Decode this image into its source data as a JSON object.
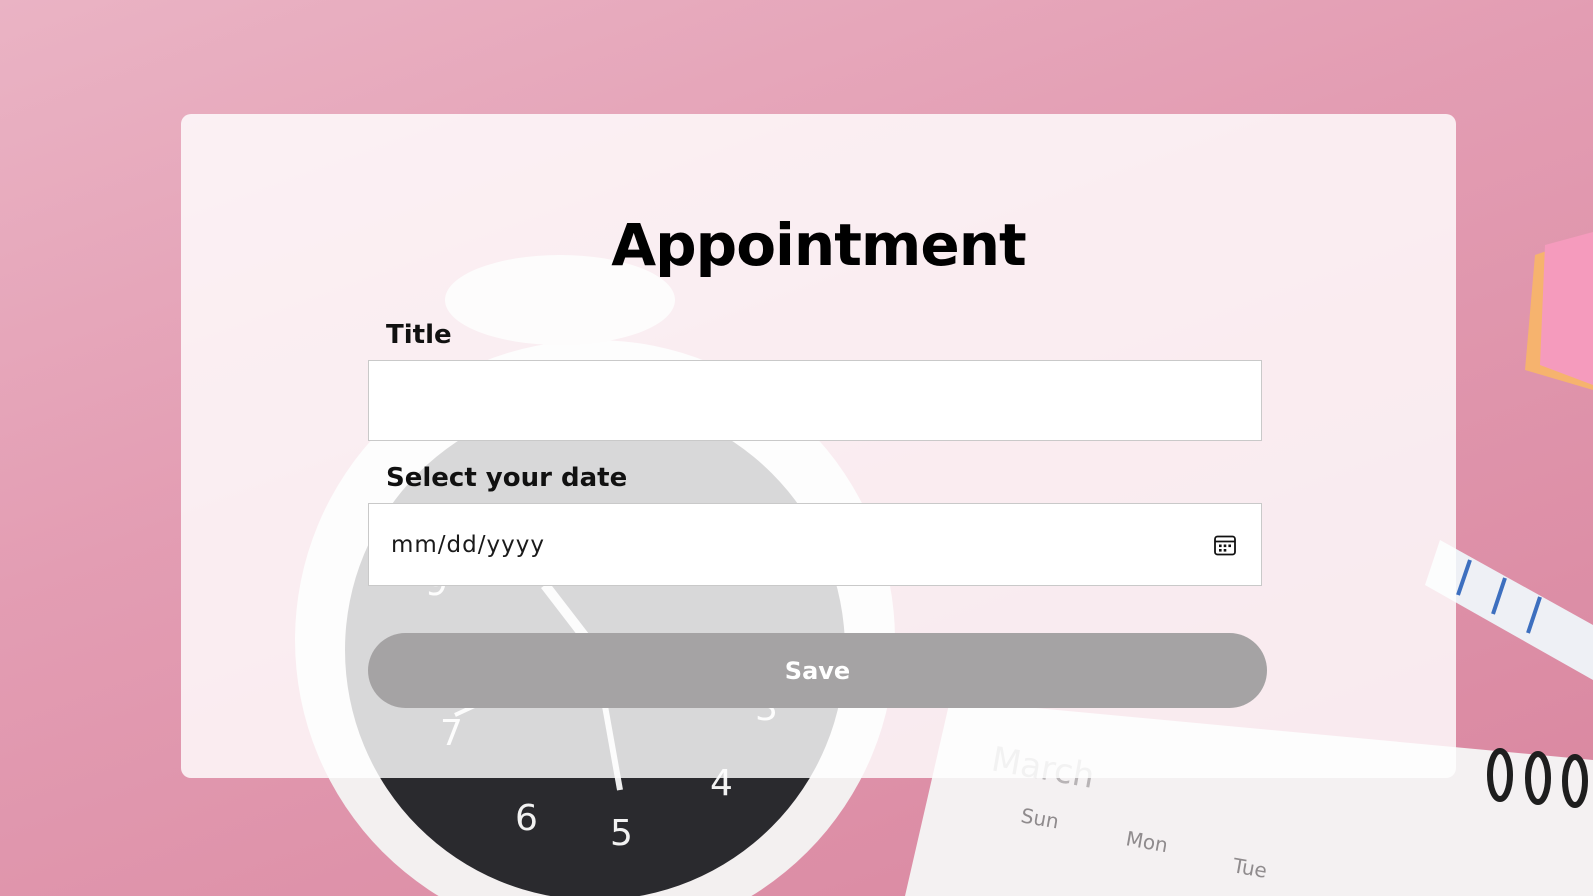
{
  "form": {
    "heading": "Appointment",
    "title_label": "Title",
    "title_value": "",
    "date_label": "Select your date",
    "date_placeholder": "mm/dd/yyyy",
    "date_icon": "calendar-icon",
    "save_label": "Save"
  },
  "background": {
    "calendar_month": "March",
    "calendar_days": [
      "Sun",
      "Mon",
      "Tue"
    ],
    "clock_numbers": [
      "9",
      "3",
      "4",
      "5",
      "6",
      "7"
    ]
  },
  "colors": {
    "background_pink": "#e39db3",
    "card": "#ffffff",
    "save_button": "#a5a3a4",
    "input_border": "#c9c9c9"
  }
}
